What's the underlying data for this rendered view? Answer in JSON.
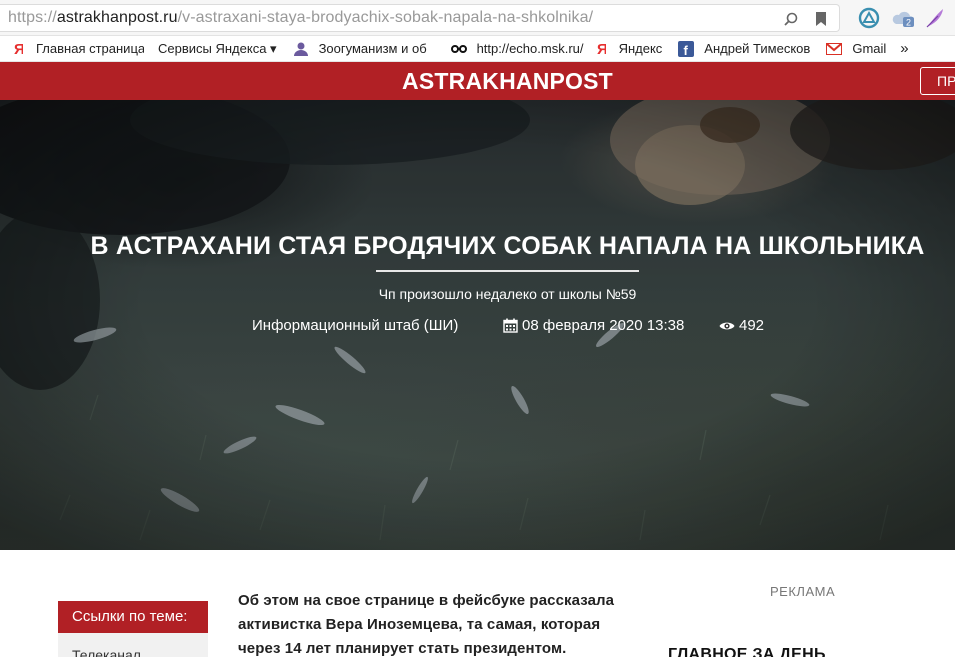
{
  "browser": {
    "url_prefix": "https://",
    "url_domain": "astrakhanpost.ru",
    "url_path": "/v-astraxani-staya-brodyachix-sobak-napala-na-shkolnika/",
    "ext_badge": "2"
  },
  "bookmarks": [
    {
      "icon": "yandex-icon",
      "label": "Главная страница"
    },
    {
      "icon": "none",
      "label": "Сервисы Яндекса ▾"
    },
    {
      "icon": "person-icon",
      "label": "Зоогуманизм и об"
    },
    {
      "icon": "echo-icon",
      "label": "http://echo.msk.ru/"
    },
    {
      "icon": "yandex-icon",
      "label": "Яндекс"
    },
    {
      "icon": "facebook-icon",
      "label": "Андрей Тимесков"
    },
    {
      "icon": "gmail-icon",
      "label": "Gmail"
    }
  ],
  "bookmarks_more": "»",
  "site": {
    "logo": "ASTRAKHANPOST",
    "header_button": "ПР"
  },
  "article": {
    "title": "В Астрахани стая бродячих собак напала на школьника",
    "subtitle": "Чп произошло недалеко от школы №59",
    "author": "Информационный штаб (ШИ)",
    "date": "08 февраля 2020 13:38",
    "views": "492",
    "lead": "Об этом на свое странице в фейсбуке рассказала активистка Вера Иноземцева, та самая, которая через 14 лет планирует стать президентом."
  },
  "sidebar": {
    "links_heading": "Ссылки по теме:",
    "links_first": "Телеканал"
  },
  "right": {
    "ad_label": "РЕКЛАМА",
    "main_heading": "ГЛАВНОЕ ЗА ДЕНЬ"
  },
  "colors": {
    "brand_red": "#b12025"
  }
}
